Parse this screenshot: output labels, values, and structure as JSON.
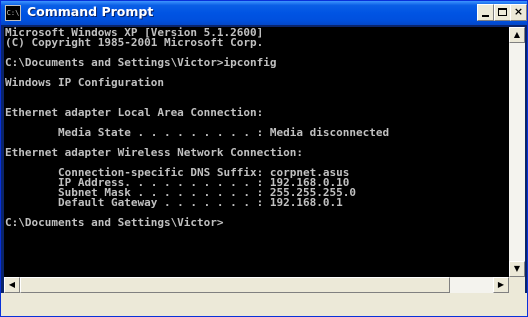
{
  "window": {
    "title": "Command Prompt",
    "app_icon": "console-icon",
    "buttons": {
      "minimize_icon": "minimize-icon",
      "maximize_icon": "maximize-icon",
      "close_icon": "close-icon",
      "close_glyph": "×"
    }
  },
  "console": {
    "lines": [
      "Microsoft Windows XP [Version 5.1.2600]",
      "(C) Copyright 1985-2001 Microsoft Corp.",
      "",
      "C:\\Documents and Settings\\Victor>ipconfig",
      "",
      "Windows IP Configuration",
      "",
      "",
      "Ethernet adapter Local Area Connection:",
      "",
      "        Media State . . . . . . . . . : Media disconnected",
      "",
      "Ethernet adapter Wireless Network Connection:",
      "",
      "        Connection-specific DNS Suffix: corpnet.asus",
      "        IP Address. . . . . . . . . . : 192.168.0.10",
      "        Subnet Mask . . . . . . . . . : 255.255.255.0",
      "        Default Gateway . . . . . . . : 192.168.0.1",
      "",
      "C:\\Documents and Settings\\Victor>"
    ]
  },
  "scrollbars": {
    "up_arrow": "▲",
    "down_arrow": "▼",
    "left_arrow": "◀",
    "right_arrow": "▶"
  },
  "colors": {
    "titlebar": "#0054e3",
    "console_bg": "#000000",
    "console_text": "#c0c0c0"
  }
}
